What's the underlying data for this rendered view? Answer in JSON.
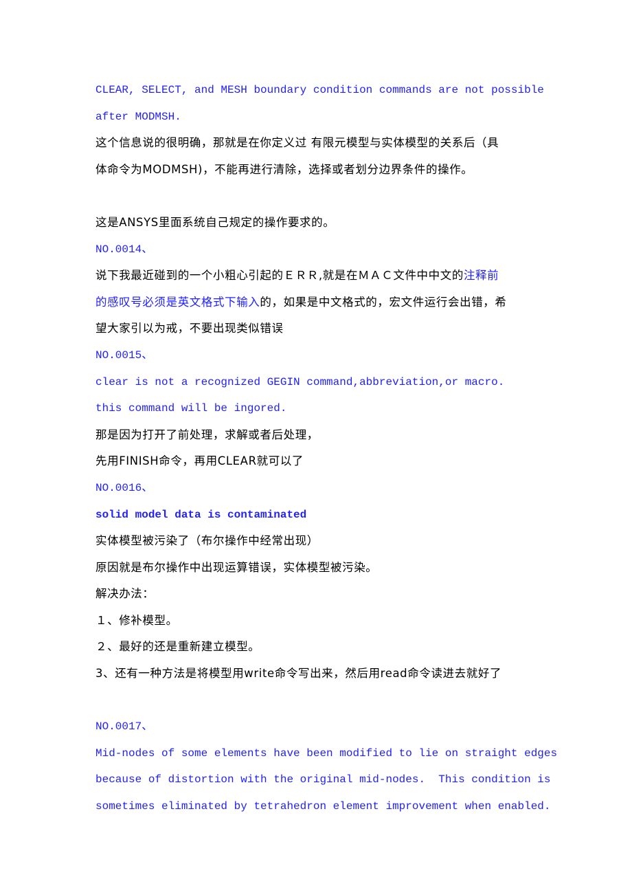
{
  "document": {
    "accent_color": "#1f1fff",
    "sections": {
      "s13": {
        "error_line1": "CLEAR, SELECT, and MESH boundary condition commands are not possible",
        "error_line2": "after MODMSH.",
        "explain_line1": "这个信息说的很明确，那就是在你定义过 有限元模型与实体模型的关系后（具",
        "explain_line2": "体命令为MODMSH)，不能再进行清除，选择或者划分边界条件的操作。",
        "explain_line3": "这是ANSYS里面系统自己规定的操作要求的。"
      },
      "s14": {
        "number": "NO.0014、",
        "para_line1_a": "说下我最近碰到的一个小粗心引起的ＥＲＲ,就是在ＭＡＣ文件中中文的",
        "para_line1_b": "注释前",
        "para_line2_a": "的感叹号必须是英文格式下输入",
        "para_line2_b": "的，如果是中文格式的，宏文件运行会出错，希",
        "para_line3": "望大家引以为戒，不要出现类似错误"
      },
      "s15": {
        "number": "NO.0015、",
        "error_line1": "clear is not a recognized GEGIN command,abbreviation,or macro.",
        "error_line2": "this command will be ingored.",
        "explain_line1": "那是因为打开了前处理，求解或者后处理，",
        "explain_line2": "先用FINISH命令，再用CLEAR就可以了"
      },
      "s16": {
        "number": "NO.0016、",
        "error_line": "solid model data is contaminated",
        "explain_line1": "实体模型被污染了（布尔操作中经常出现）",
        "explain_line2": "原因就是布尔操作中出现运算错误，实体模型被污染。",
        "solutions_label": "解决办法：",
        "solutions": [
          " １、修补模型。",
          " ２、最好的还是重新建立模型。",
          "3、还有一种方法是将模型用write命令写出来，然后用read命令读进去就好了"
        ]
      },
      "s17": {
        "number": "NO.0017、",
        "error_line1": "Mid-nodes of some elements have been modified to lie on straight edges",
        "error_line2": "because of distortion with the original mid-nodes.  This condition is",
        "error_line3": "sometimes eliminated by tetrahedron element improvement when enabled."
      }
    }
  }
}
